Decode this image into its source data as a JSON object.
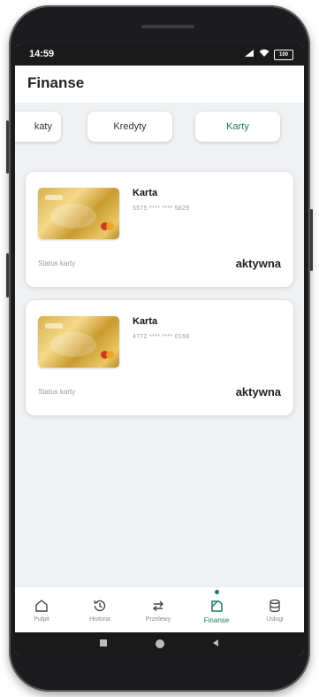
{
  "status_bar": {
    "time": "14:59",
    "signal_icon": "signal-icon",
    "wifi_icon": "wifi-icon",
    "battery_text": "100"
  },
  "header": {
    "title": "Finanse"
  },
  "tabs": [
    {
      "label": "Lokaty",
      "visible_label": "katy",
      "active": false
    },
    {
      "label": "Kredyty",
      "active": false
    },
    {
      "label": "Karty",
      "active": true
    }
  ],
  "cards": [
    {
      "name": "Karta",
      "number": "5575 **** **** 5829",
      "status_label": "Status karty",
      "status_value": "aktywna"
    },
    {
      "name": "Karta",
      "number": "4772 **** **** 0168",
      "status_label": "Status karty",
      "status_value": "aktywna"
    }
  ],
  "bottom_nav": [
    {
      "label": "Pulpit",
      "icon": "home-icon",
      "active": false
    },
    {
      "label": "Historia",
      "icon": "history-icon",
      "active": false
    },
    {
      "label": "Przelewy",
      "icon": "transfer-icon",
      "active": false
    },
    {
      "label": "Finanse",
      "icon": "finance-icon",
      "active": true
    },
    {
      "label": "Usługi",
      "icon": "services-icon",
      "active": false
    }
  ],
  "system_nav": {
    "recent_icon": "recent-apps-icon",
    "home_icon": "home-circle-icon",
    "back_icon": "back-icon"
  },
  "colors": {
    "accent": "#1f7a63",
    "background": "#f0f1f2",
    "card_gold": "#d8b24a"
  }
}
